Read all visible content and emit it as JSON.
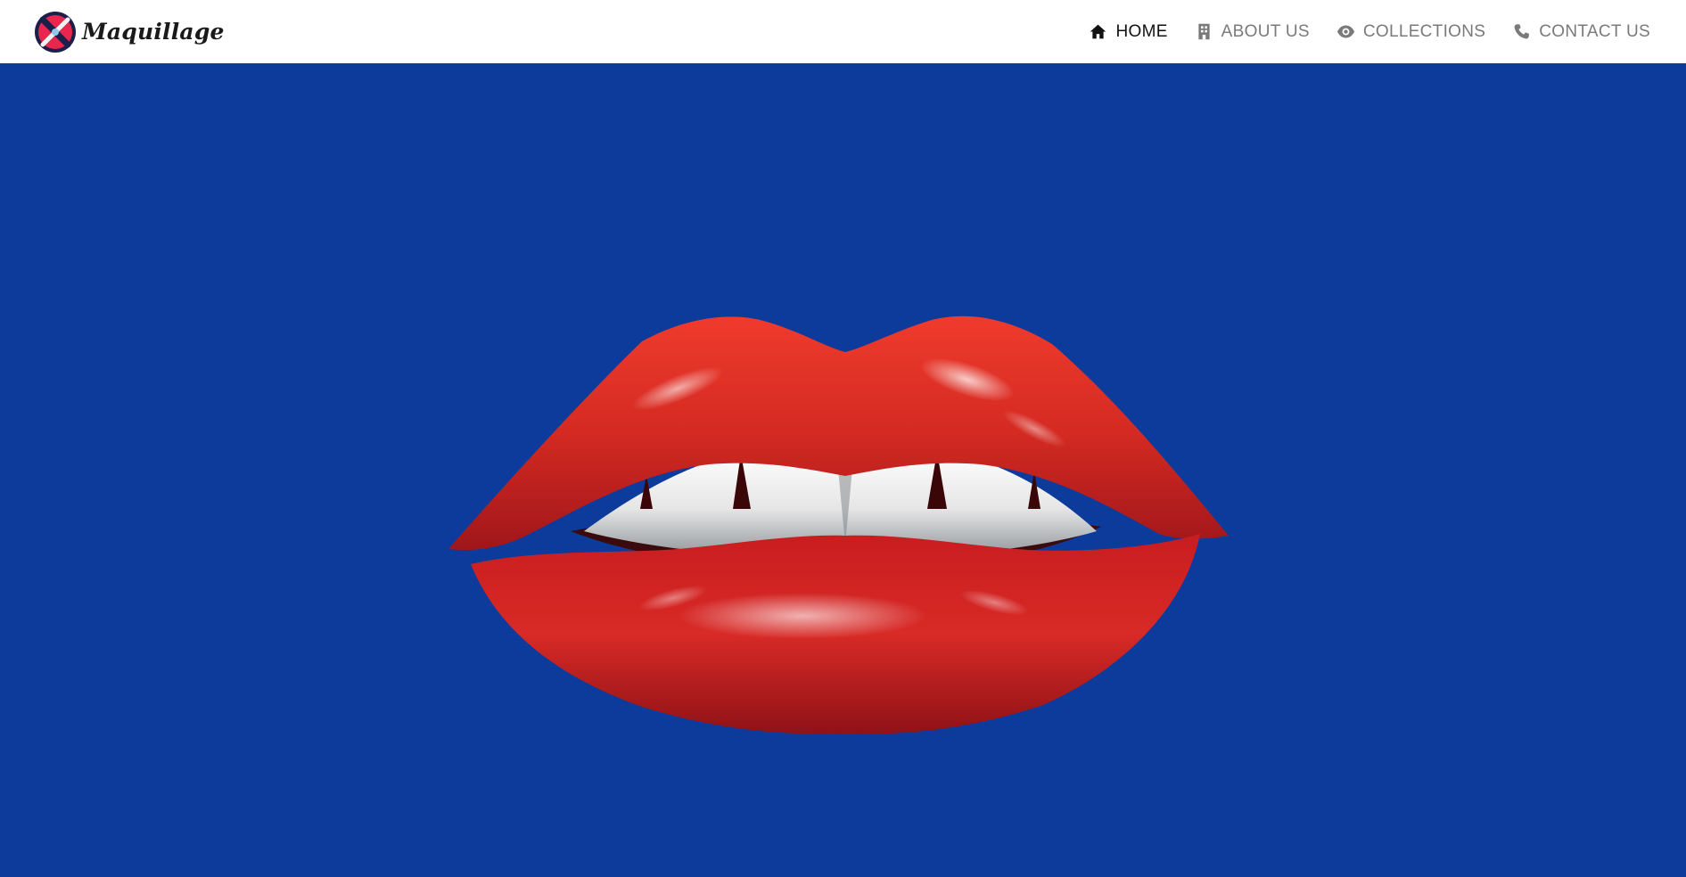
{
  "brand": {
    "name": "Maquillage",
    "logo_icon": "brush-logo-icon"
  },
  "nav": {
    "items": [
      {
        "label": "HOME",
        "icon": "home-icon",
        "active": true
      },
      {
        "label": "ABOUT US",
        "icon": "building-icon",
        "active": false
      },
      {
        "label": "COLLECTIONS",
        "icon": "eye-icon",
        "active": false
      },
      {
        "label": "CONTACT US",
        "icon": "phone-icon",
        "active": false
      }
    ]
  },
  "colors": {
    "hero_background": "#0c3b9c",
    "lip_red": "#c01f1f",
    "nav_active": "#111111",
    "nav_inactive": "#7a7a7a",
    "logo_circle": "#1b1f4a",
    "logo_accent": "#e8264e"
  },
  "hero": {
    "image": "red-lips-illustration"
  }
}
